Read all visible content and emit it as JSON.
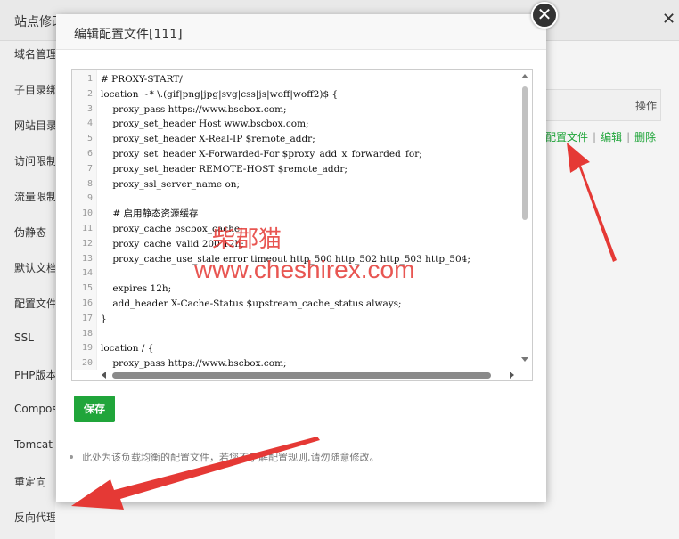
{
  "background": {
    "panel_title": "站点修改",
    "close_glyph": "✕",
    "sidebar_items": [
      "域名管理",
      "子目录绑定",
      "网站目录",
      "访问限制",
      "流量限制",
      "伪静态",
      "默认文档",
      "配置文件",
      "SSL",
      "PHP版本",
      "Composer",
      "Tomcat",
      "重定向",
      "反向代理"
    ],
    "table_op_header": "操作",
    "actions": [
      "配置文件",
      "编辑",
      "删除"
    ],
    "action_separator": "|"
  },
  "modal": {
    "title": "编辑配置文件[111]",
    "close_glyph": "✕",
    "save_label": "保存",
    "tip": "此处为该负载均衡的配置文件，若您不了解配置规则,请勿随意修改。"
  },
  "editor": {
    "lines": [
      "# PROXY-START/",
      "location ~* \\.(gif|png|jpg|svg|css|js|woff|woff2)$ {",
      "    proxy_pass https://www.bscbox.com;",
      "    proxy_set_header Host www.bscbox.com;",
      "    proxy_set_header X-Real-IP $remote_addr;",
      "    proxy_set_header X-Forwarded-For $proxy_add_x_forwarded_for;",
      "    proxy_set_header REMOTE-HOST $remote_addr;",
      "    proxy_ssl_server_name on;",
      "",
      "    # 启用静态资源缓存",
      "    proxy_cache bscbox_cache;",
      "    proxy_cache_valid 200 12h;",
      "    proxy_cache_use_stale error timeout http_500 http_502 http_503 http_504;",
      "",
      "    expires 12h;",
      "    add_header X-Cache-Status $upstream_cache_status always;",
      "}",
      "",
      "location / {",
      "    proxy_pass https://www.bscbox.com;"
    ]
  },
  "watermark": {
    "cn": "柴郡猫",
    "url": "www.cheshirex.com"
  },
  "colors": {
    "accent_green": "#20a53a",
    "arrow_red": "#e53935"
  }
}
